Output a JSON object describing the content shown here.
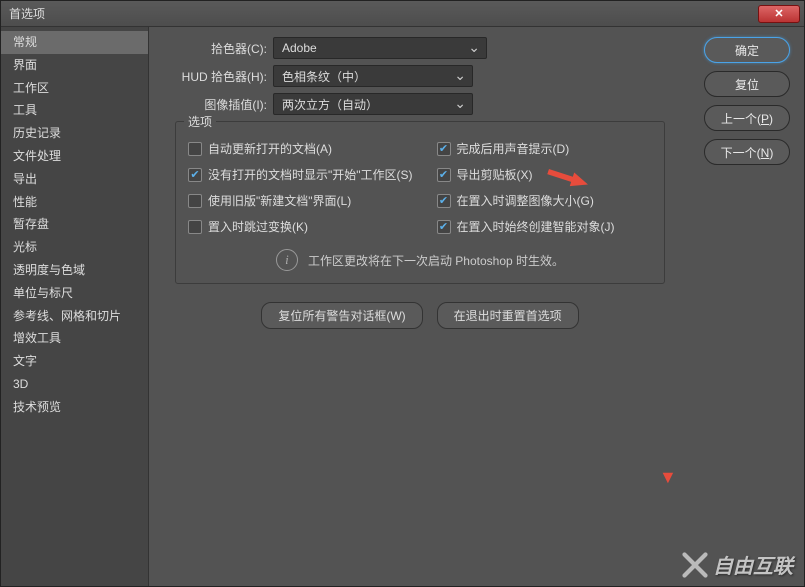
{
  "title": "首选项",
  "sidebar": {
    "items": [
      "常规",
      "界面",
      "工作区",
      "工具",
      "历史记录",
      "文件处理",
      "导出",
      "性能",
      "暂存盘",
      "光标",
      "透明度与色域",
      "单位与标尺",
      "参考线、网格和切片",
      "增效工具",
      "文字",
      "3D",
      "技术预览"
    ],
    "activeIndex": 0
  },
  "dropdowns": {
    "picker_label": "拾色器(C):",
    "picker_value": "Adobe",
    "hud_label": "HUD 拾色器(H):",
    "hud_value": "色相条纹（中）",
    "interp_label": "图像插值(I):",
    "interp_value": "两次立方（自动）"
  },
  "options": {
    "legend": "选项",
    "left": [
      {
        "checked": false,
        "label": "自动更新打开的文档(A)"
      },
      {
        "checked": true,
        "label": "没有打开的文档时显示\"开始\"工作区(S)"
      },
      {
        "checked": false,
        "label": "使用旧版\"新建文档\"界面(L)"
      },
      {
        "checked": false,
        "label": "置入时跳过变换(K)"
      }
    ],
    "right": [
      {
        "checked": true,
        "label": "完成后用声音提示(D)"
      },
      {
        "checked": true,
        "label": "导出剪贴板(X)"
      },
      {
        "checked": true,
        "label": "在置入时调整图像大小(G)"
      },
      {
        "checked": true,
        "label": "在置入时始终创建智能对象(J)"
      }
    ],
    "info": "工作区更改将在下一次启动 Photoshop 时生效。"
  },
  "buttons": {
    "reset_warnings": "复位所有警告对话框(W)",
    "reset_on_quit": "在退出时重置首选项",
    "ok": "确定",
    "cancel": "复位",
    "prev": "上一个(P)",
    "next": "下一个(N)"
  },
  "watermark": "自由互联"
}
